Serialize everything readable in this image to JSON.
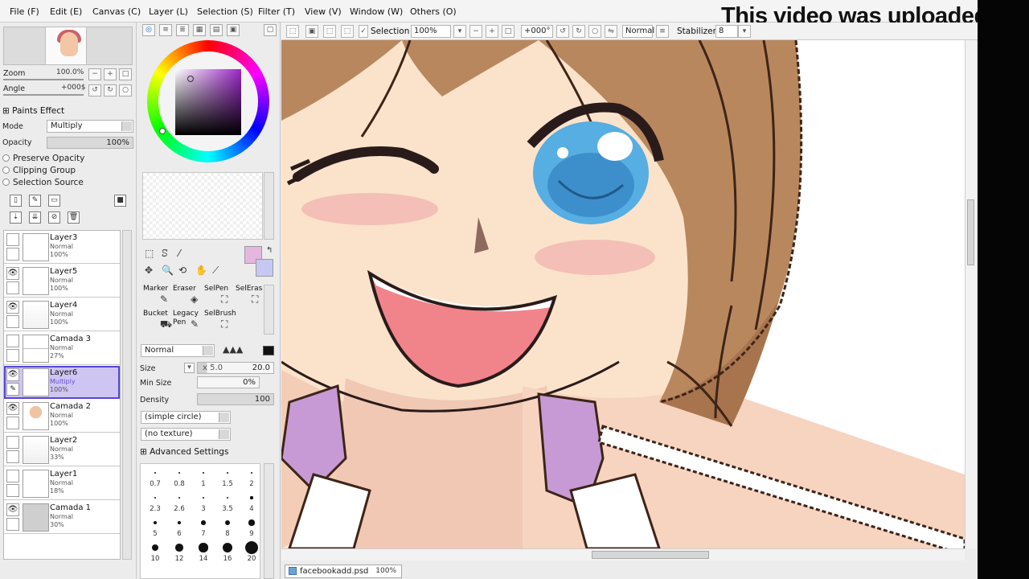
{
  "menu": [
    {
      "label": "File (F)"
    },
    {
      "label": "Edit (E)"
    },
    {
      "label": "Canvas (C)"
    },
    {
      "label": "Layer (L)"
    },
    {
      "label": "Selection (S)"
    },
    {
      "label": "Filter (T)"
    },
    {
      "label": "View (V)"
    },
    {
      "label": "Window (W)"
    },
    {
      "label": "Others (O)"
    }
  ],
  "overlay_text": "This video was uploaded t",
  "navigator": {
    "zoom_label": "Zoom",
    "zoom_value": "100.0%",
    "angle_label": "Angle",
    "angle_value": "+000$"
  },
  "paint_effect": {
    "title": "Paints Effect",
    "mode_label": "Mode",
    "mode_value": "Multiply",
    "opacity_label": "Opacity",
    "opacity_value": "100%",
    "options": [
      "Preserve Opacity",
      "Clipping Group",
      "Selection Source"
    ]
  },
  "layers": [
    {
      "name": "Layer3",
      "mode": "Normal",
      "opacity": "100%",
      "visible": false,
      "selected": false,
      "thumb": "white"
    },
    {
      "name": "Layer5",
      "mode": "Normal",
      "opacity": "100%",
      "visible": true,
      "selected": false,
      "thumb": "white"
    },
    {
      "name": "Layer4",
      "mode": "Normal",
      "opacity": "100%",
      "visible": true,
      "selected": false,
      "thumb": "sketch"
    },
    {
      "name": "Camada 3",
      "mode": "Normal",
      "opacity": "27%",
      "visible": false,
      "selected": false,
      "thumb": "line"
    },
    {
      "name": "Layer6",
      "mode": "Multiply",
      "opacity": "100%",
      "visible": true,
      "selected": true,
      "thumb": "white"
    },
    {
      "name": "Camada 2",
      "mode": "Normal",
      "opacity": "100%",
      "visible": true,
      "selected": false,
      "thumb": "figure"
    },
    {
      "name": "Layer2",
      "mode": "Normal",
      "opacity": "33%",
      "visible": false,
      "selected": false,
      "thumb": "sketch"
    },
    {
      "name": "Layer1",
      "mode": "Normal",
      "opacity": "18%",
      "visible": false,
      "selected": false,
      "thumb": "white"
    },
    {
      "name": "Camada 1",
      "mode": "Normal",
      "opacity": "30%",
      "visible": true,
      "selected": false,
      "thumb": "gray"
    }
  ],
  "tools": {
    "row1": [
      "Marker",
      "Eraser",
      "SelPen",
      "SelEras"
    ],
    "row2": [
      "Bucket",
      "Legacy Pen",
      "SelBrush"
    ]
  },
  "brush": {
    "blend_mode": "Normal",
    "size_label": "Size",
    "size_multiplier": "x 5.0",
    "size_value": "20.0",
    "min_size_label": "Min Size",
    "min_size_value": "0%",
    "density_label": "Density",
    "density_value": "100",
    "shape": "(simple circle)",
    "texture": "(no texture)",
    "advanced_label": "Advanced Settings",
    "sizes": [
      "0.7",
      "0.8",
      "1",
      "1.5",
      "2",
      "2.3",
      "2.6",
      "3",
      "3.5",
      "4",
      "5",
      "6",
      "7",
      "8",
      "9",
      "10",
      "12",
      "14",
      "16",
      "20"
    ]
  },
  "canvas_toolbar": {
    "selection_label": "Selection",
    "zoom_value": "100%",
    "angle_value": "+000°",
    "mode_value": "Normal",
    "stabilizer_label": "Stabilizer",
    "stabilizer_value": "8"
  },
  "status": {
    "file_name": "facebookadd.psd",
    "zoom": "100%"
  },
  "colors": {
    "foreground": "#e5b6e0",
    "background": "#c7c8f2",
    "selection": "#cfc5f3"
  }
}
